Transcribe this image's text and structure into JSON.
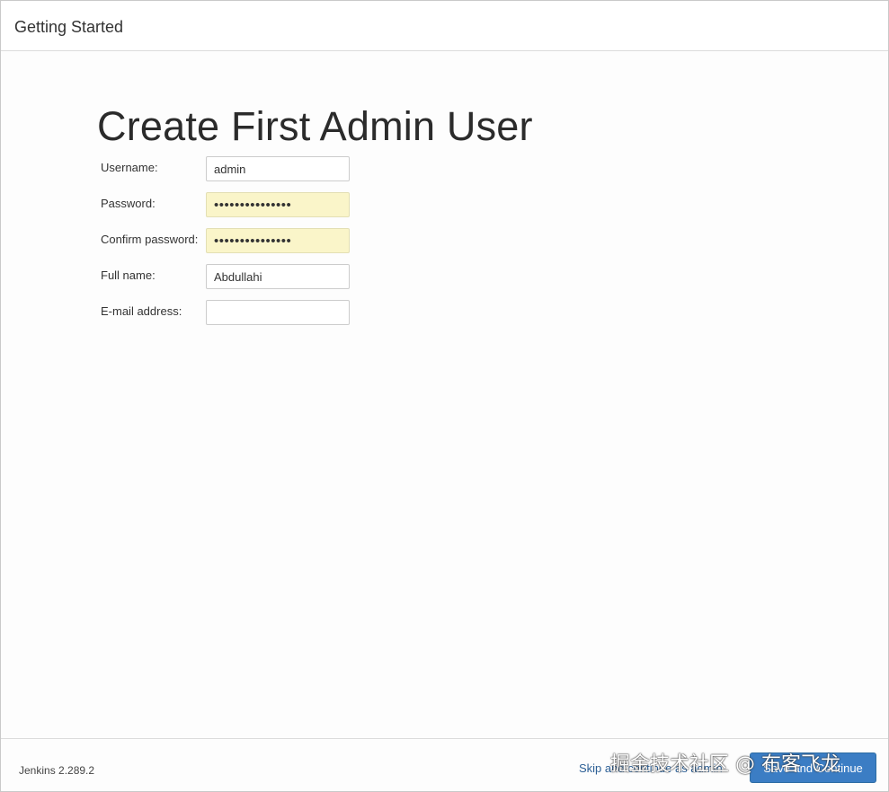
{
  "header": {
    "title": "Getting Started"
  },
  "main": {
    "title": "Create First Admin User",
    "fields": [
      {
        "label": "Username:",
        "value": "admin",
        "type": "text"
      },
      {
        "label": "Password:",
        "value": "•••••••••••••••",
        "type": "password"
      },
      {
        "label": "Confirm password:",
        "value": "•••••••••••••••",
        "type": "password"
      },
      {
        "label": "Full name:",
        "value": "Abdullahi",
        "type": "text"
      },
      {
        "label": "E-mail address:",
        "value": "",
        "type": "email"
      }
    ]
  },
  "footer": {
    "version": "Jenkins 2.289.2",
    "skip_label": "Skip and continue as admin",
    "save_label": "Save and Continue",
    "watermark": "掘金技术社区 @ 布客飞龙"
  },
  "colors": {
    "primary_button": "#3b7dc4",
    "link": "#2c5f95",
    "autofill": "#faf5c9"
  }
}
